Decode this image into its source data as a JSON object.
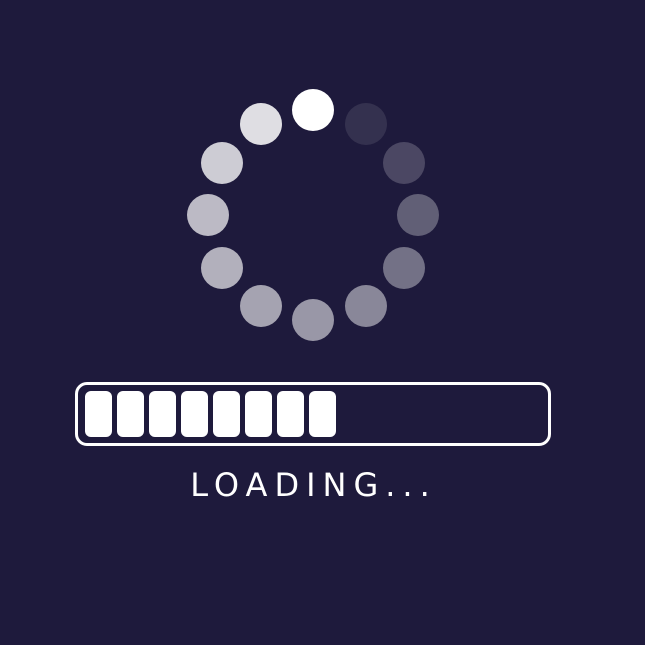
{
  "colors": {
    "background": "#1e1a3c",
    "foreground": "#ffffff"
  },
  "spinner": {
    "icon": "spinner-icon",
    "dot_count": 12,
    "dot_opacities": [
      1.0,
      0.86,
      0.78,
      0.7,
      0.66,
      0.6,
      0.55,
      0.48,
      0.38,
      0.3,
      0.2,
      0.1
    ]
  },
  "progress": {
    "total_segments": 15,
    "filled_segments": 8,
    "fraction": 0.53
  },
  "status": {
    "text": "LOADING..."
  }
}
